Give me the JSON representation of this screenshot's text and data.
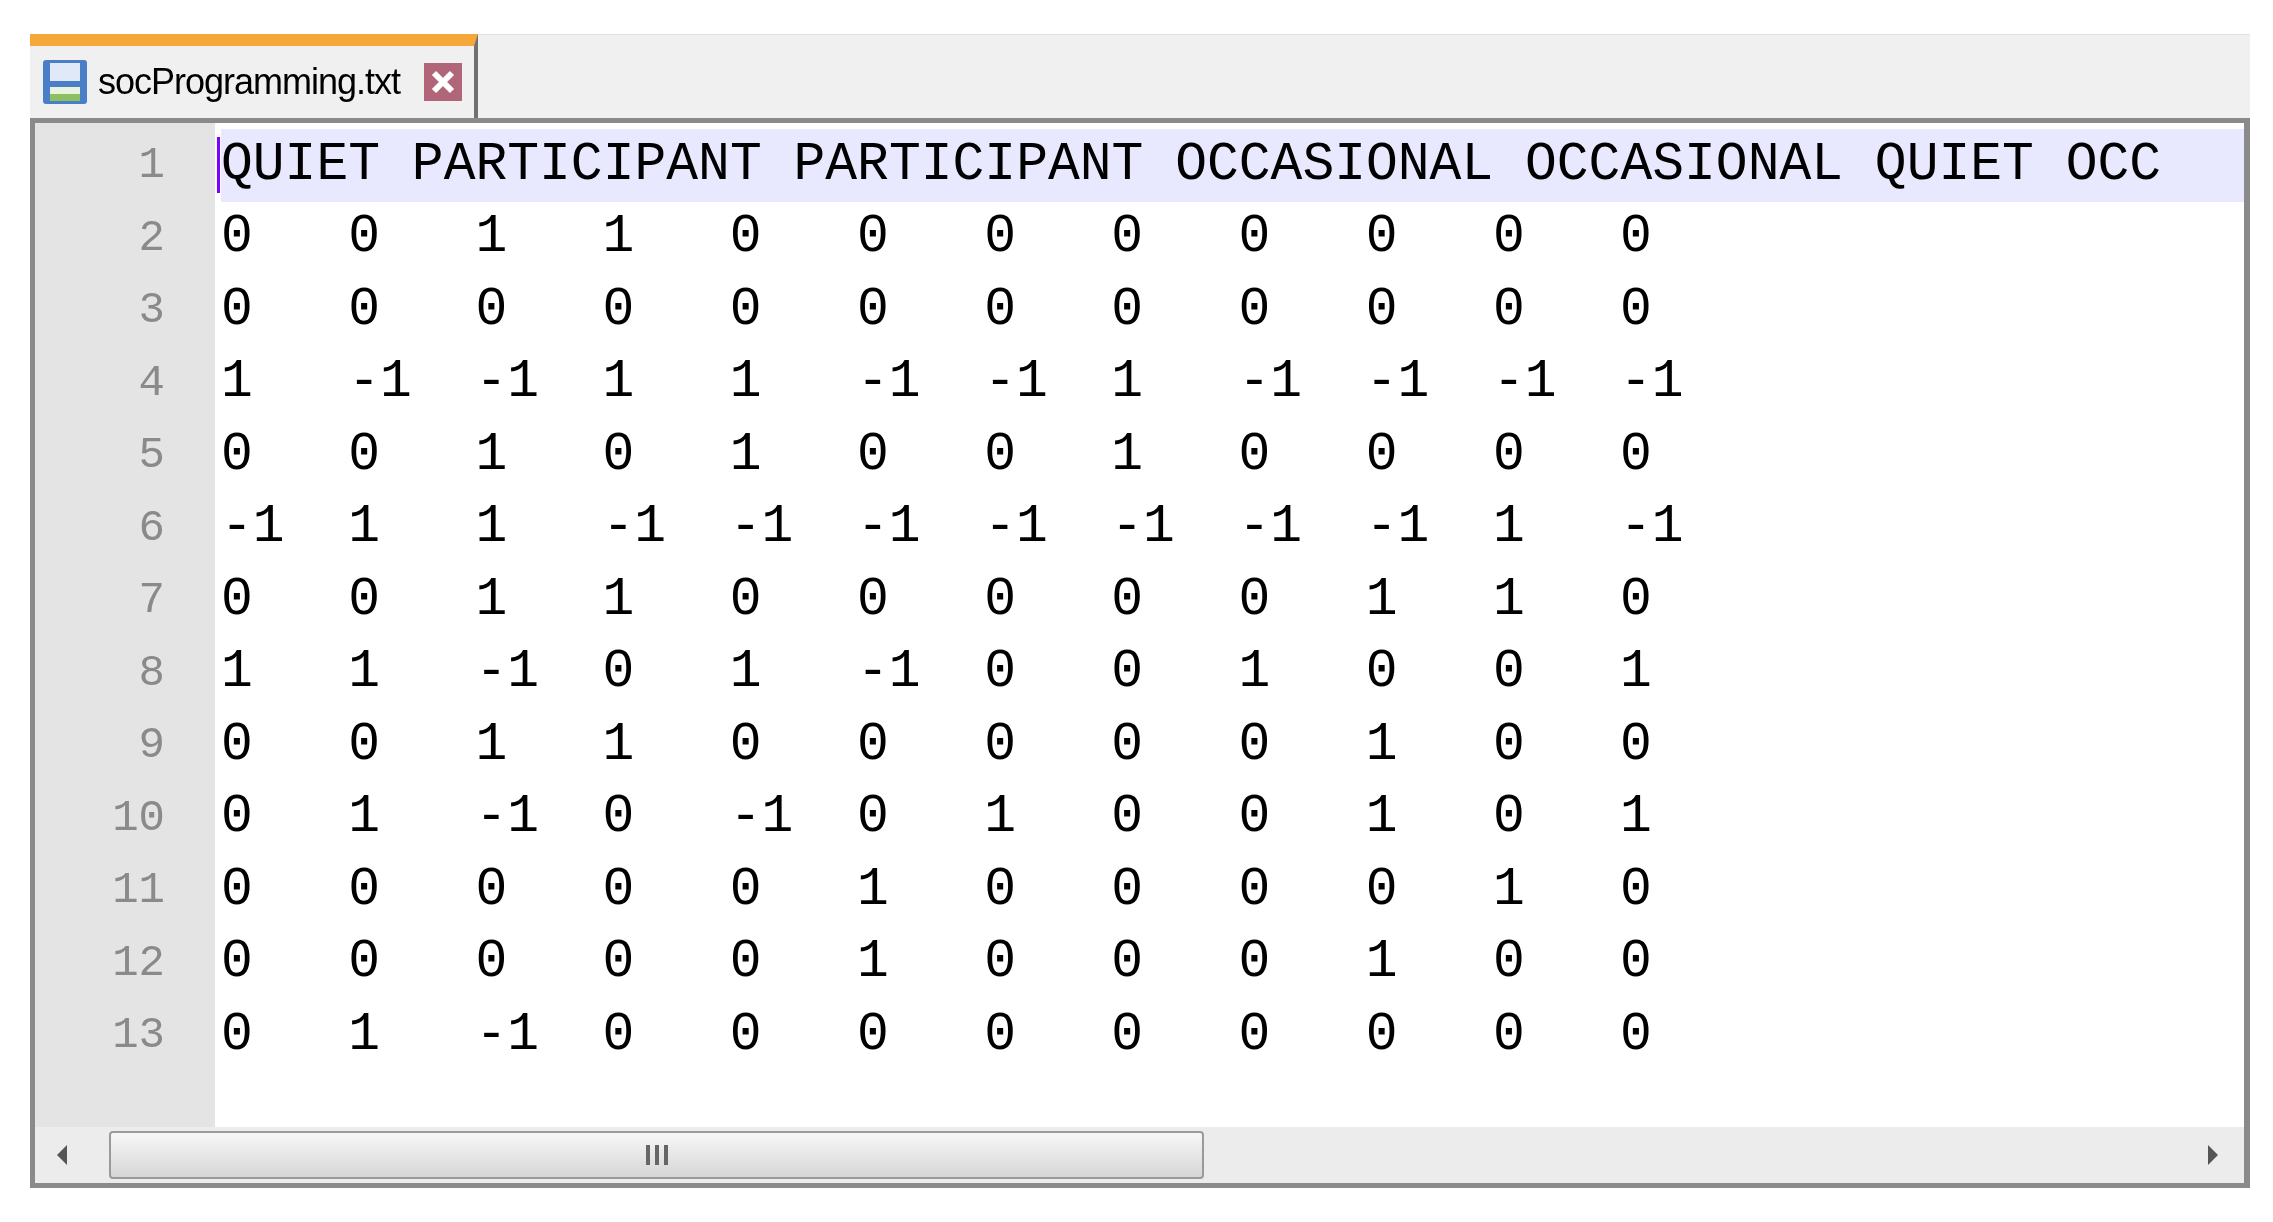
{
  "tabs": [
    {
      "label": "socProgramming.txt",
      "selected": true
    }
  ],
  "editor": {
    "lines": [
      {
        "number": "1",
        "current": true,
        "kind": "text",
        "text": "QUIET PARTICIPANT PARTICIPANT OCCASIONAL OCCASIONAL QUIET OCC"
      },
      {
        "number": "2",
        "current": false,
        "kind": "values",
        "values": [
          "0",
          "0",
          "1",
          "1",
          "0",
          "0",
          "0",
          "0",
          "0",
          "0",
          "0",
          "0"
        ]
      },
      {
        "number": "3",
        "current": false,
        "kind": "values",
        "values": [
          "0",
          "0",
          "0",
          "0",
          "0",
          "0",
          "0",
          "0",
          "0",
          "0",
          "0",
          "0"
        ]
      },
      {
        "number": "4",
        "current": false,
        "kind": "values",
        "values": [
          "1",
          "-1",
          "-1",
          "1",
          "1",
          "-1",
          "-1",
          "1",
          "-1",
          "-1",
          "-1",
          "-1"
        ]
      },
      {
        "number": "5",
        "current": false,
        "kind": "values",
        "values": [
          "0",
          "0",
          "1",
          "0",
          "1",
          "0",
          "0",
          "1",
          "0",
          "0",
          "0",
          "0"
        ]
      },
      {
        "number": "6",
        "current": false,
        "kind": "values",
        "values": [
          "-1",
          "1",
          "1",
          "-1",
          "-1",
          "-1",
          "-1",
          "-1",
          "-1",
          "-1",
          "1",
          "-1"
        ]
      },
      {
        "number": "7",
        "current": false,
        "kind": "values",
        "values": [
          "0",
          "0",
          "1",
          "1",
          "0",
          "0",
          "0",
          "0",
          "0",
          "1",
          "1",
          "0"
        ]
      },
      {
        "number": "8",
        "current": false,
        "kind": "values",
        "values": [
          "1",
          "1",
          "-1",
          "0",
          "1",
          "-1",
          "0",
          "0",
          "1",
          "0",
          "0",
          "1"
        ]
      },
      {
        "number": "9",
        "current": false,
        "kind": "values",
        "values": [
          "0",
          "0",
          "1",
          "1",
          "0",
          "0",
          "0",
          "0",
          "0",
          "1",
          "0",
          "0"
        ]
      },
      {
        "number": "10",
        "current": false,
        "kind": "values",
        "values": [
          "0",
          "1",
          "-1",
          "0",
          "-1",
          "0",
          "1",
          "0",
          "0",
          "1",
          "0",
          "1"
        ]
      },
      {
        "number": "11",
        "current": false,
        "kind": "values",
        "values": [
          "0",
          "0",
          "0",
          "0",
          "0",
          "1",
          "0",
          "0",
          "0",
          "0",
          "1",
          "0"
        ]
      },
      {
        "number": "12",
        "current": false,
        "kind": "values",
        "values": [
          "0",
          "0",
          "0",
          "0",
          "0",
          "1",
          "0",
          "0",
          "0",
          "1",
          "0",
          "0"
        ]
      },
      {
        "number": "13",
        "current": false,
        "kind": "values",
        "values": [
          "0",
          "1",
          "-1",
          "0",
          "0",
          "0",
          "0",
          "0",
          "0",
          "0",
          "0",
          "0"
        ]
      }
    ]
  }
}
